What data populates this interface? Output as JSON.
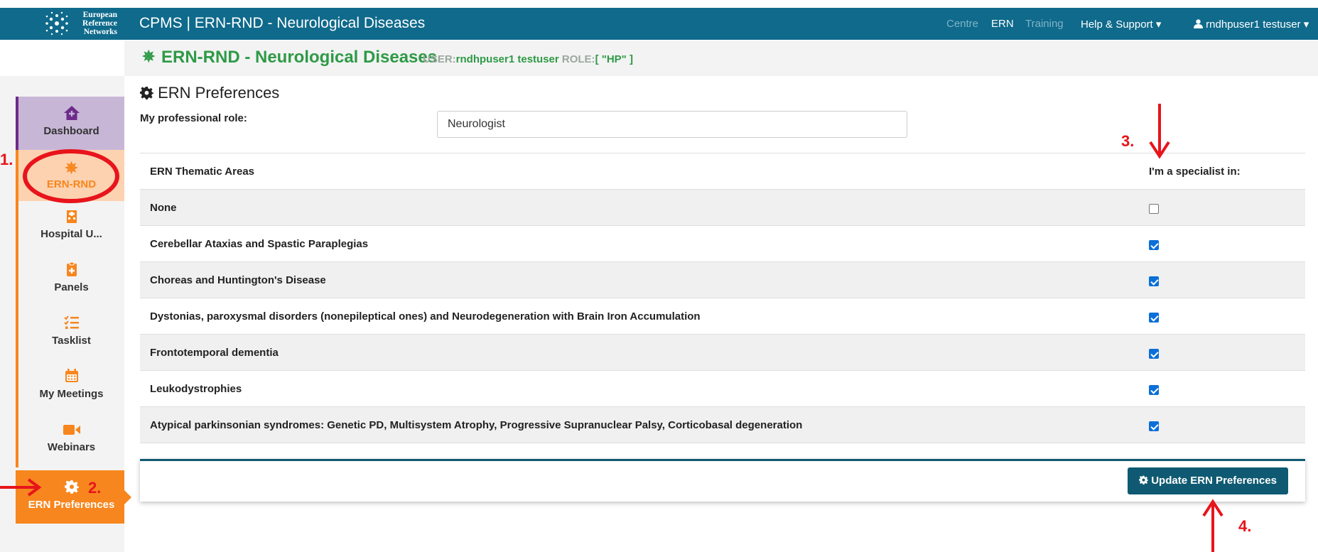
{
  "header": {
    "logo_lines": [
      "European",
      "Reference",
      "Networks"
    ],
    "title": "CPMS | ERN-RND - Neurological Diseases",
    "nav": [
      "Centre",
      "ERN",
      "Training"
    ],
    "help": "Help & Support ▾",
    "user": "rndhpuser1 testuser ▾"
  },
  "subheader": {
    "icon": "✵",
    "title": "ERN-RND - Neurological Diseases",
    "user_label": "USER:",
    "user_value": "rndhpuser1 testuser",
    "role_label": "ROLE:",
    "role_value": "[ \"HP\" ]"
  },
  "sidebar": {
    "items": [
      {
        "label": "Dashboard",
        "icon": "home-icon"
      },
      {
        "label": "ERN-RND",
        "icon": "network-icon"
      },
      {
        "label": "Hospital U...",
        "icon": "hospital-icon"
      },
      {
        "label": "Panels",
        "icon": "clipboard-icon"
      },
      {
        "label": "Tasklist",
        "icon": "tasklist-icon"
      },
      {
        "label": "My Meetings",
        "icon": "calendar-icon"
      },
      {
        "label": "Webinars",
        "icon": "video-icon"
      },
      {
        "label": "ERN Preferences",
        "icon": "gear-icon"
      }
    ]
  },
  "main": {
    "section_title": "ERN Preferences",
    "role_label": "My professional role:",
    "role_value": "Neurologist",
    "table": {
      "headers": [
        "ERN Thematic Areas",
        "I'm a specialist in:"
      ],
      "rows": [
        {
          "name": "None",
          "checked": false
        },
        {
          "name": "Cerebellar Ataxias and Spastic Paraplegias",
          "checked": true
        },
        {
          "name": "Choreas and Huntington's Disease",
          "checked": true
        },
        {
          "name": "Dystonias, paroxysmal disorders (nonepileptical ones) and Neurodegeneration with Brain Iron Accumulation",
          "checked": true
        },
        {
          "name": "Frontotemporal dementia",
          "checked": true
        },
        {
          "name": "Leukodystrophies",
          "checked": true
        },
        {
          "name": "Atypical parkinsonian syndromes: Genetic PD, Multisystem Atrophy, Progressive Supranuclear Palsy, Corticobasal degeneration",
          "checked": true
        }
      ]
    },
    "update_button": "Update ERN Preferences"
  },
  "annotations": [
    "1.",
    "2.",
    "3.",
    "4."
  ],
  "colors": {
    "topbar": "#0f6a8b",
    "brand_green": "#2e9a46",
    "accent_orange": "#f7861e",
    "dashboard_purple": "#6d2b8a",
    "annotation_red": "#e8141b"
  }
}
